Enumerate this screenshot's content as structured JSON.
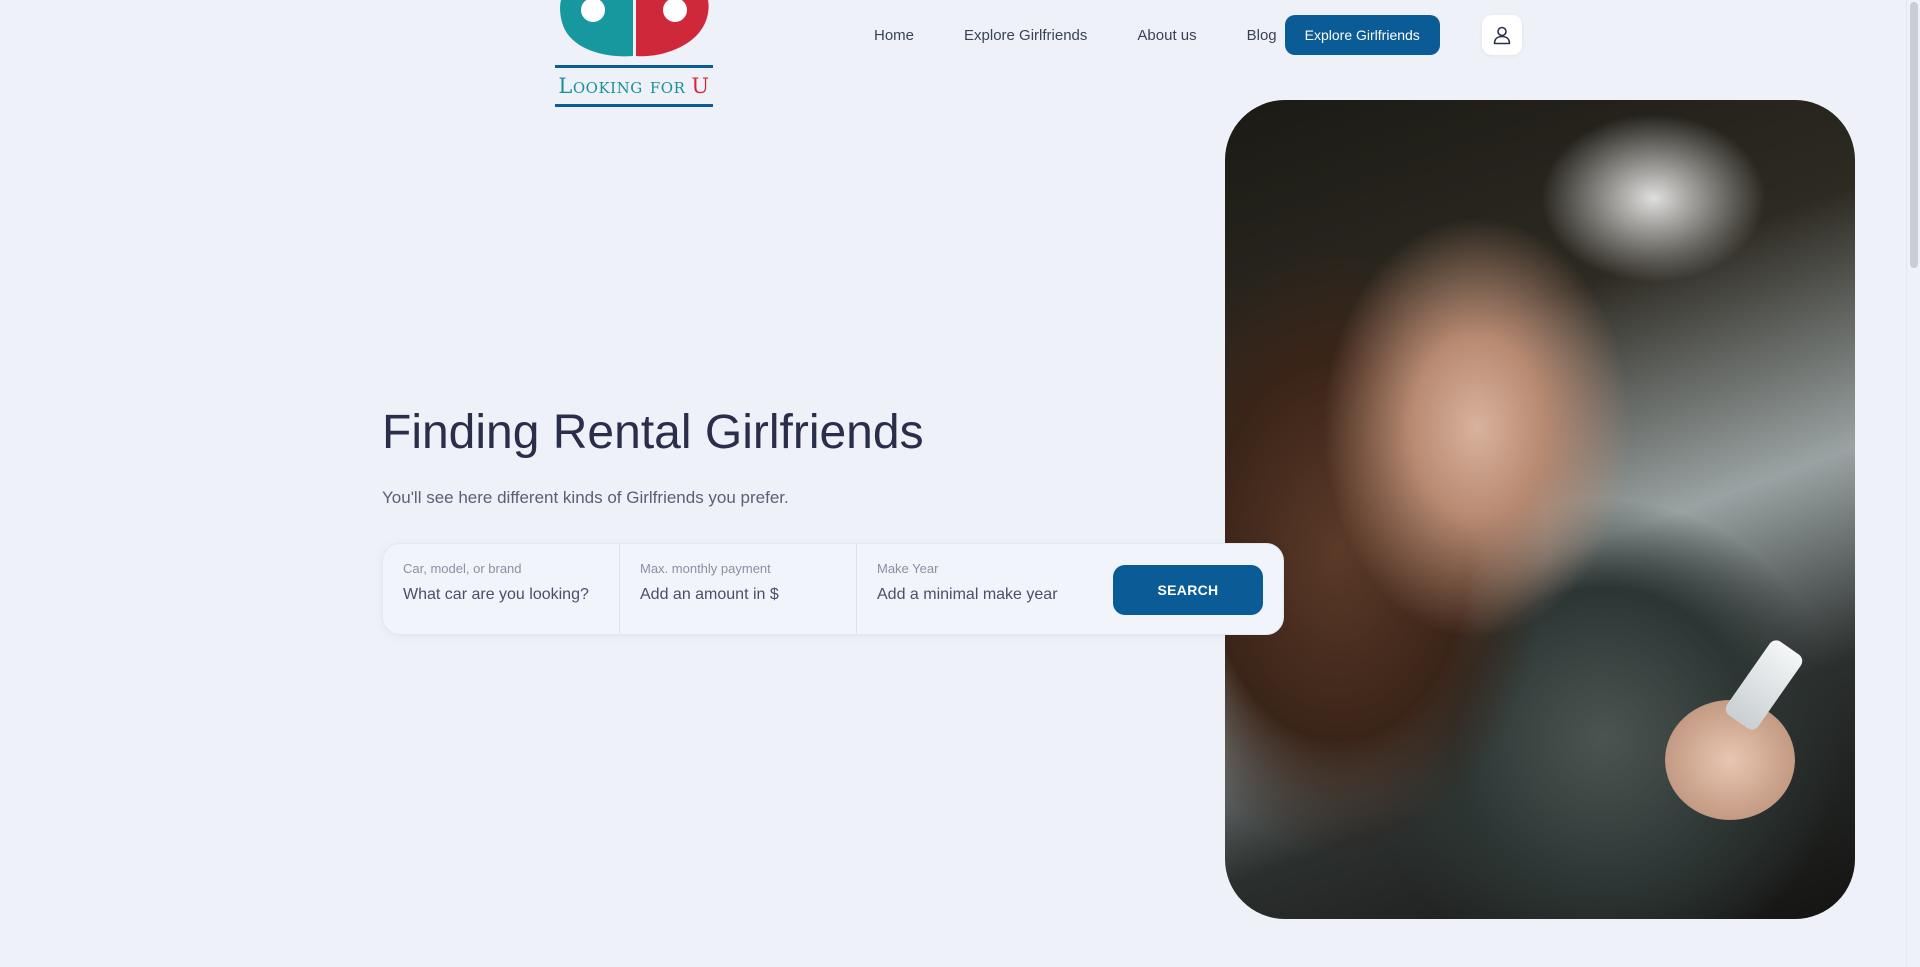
{
  "logo": {
    "text_main": "Looking for",
    "text_accent": "U",
    "colors": {
      "teal": "#17989e",
      "red": "#d0283b",
      "navy": "#0b5b96"
    }
  },
  "nav": {
    "links": [
      "Home",
      "Explore Girlfriends",
      "About us",
      "Blog"
    ],
    "cta_label": "Explore Girlfriends",
    "user_icon": "user-icon"
  },
  "hero": {
    "title": "Finding Rental Girlfriends",
    "subtitle": "You'll see here different kinds of Girlfriends you prefer."
  },
  "search": {
    "fields": [
      {
        "label": "Car, model, or brand",
        "placeholder": "What car are you looking?"
      },
      {
        "label": "Max. monthly payment",
        "placeholder": "Add an amount in $"
      },
      {
        "label": "Make Year",
        "placeholder": "Add a minimal make year"
      }
    ],
    "button_label": "SEARCH"
  },
  "theme": {
    "background": "#eef2f8",
    "primary": "#0b5b96",
    "text": "#2b2e4a"
  }
}
